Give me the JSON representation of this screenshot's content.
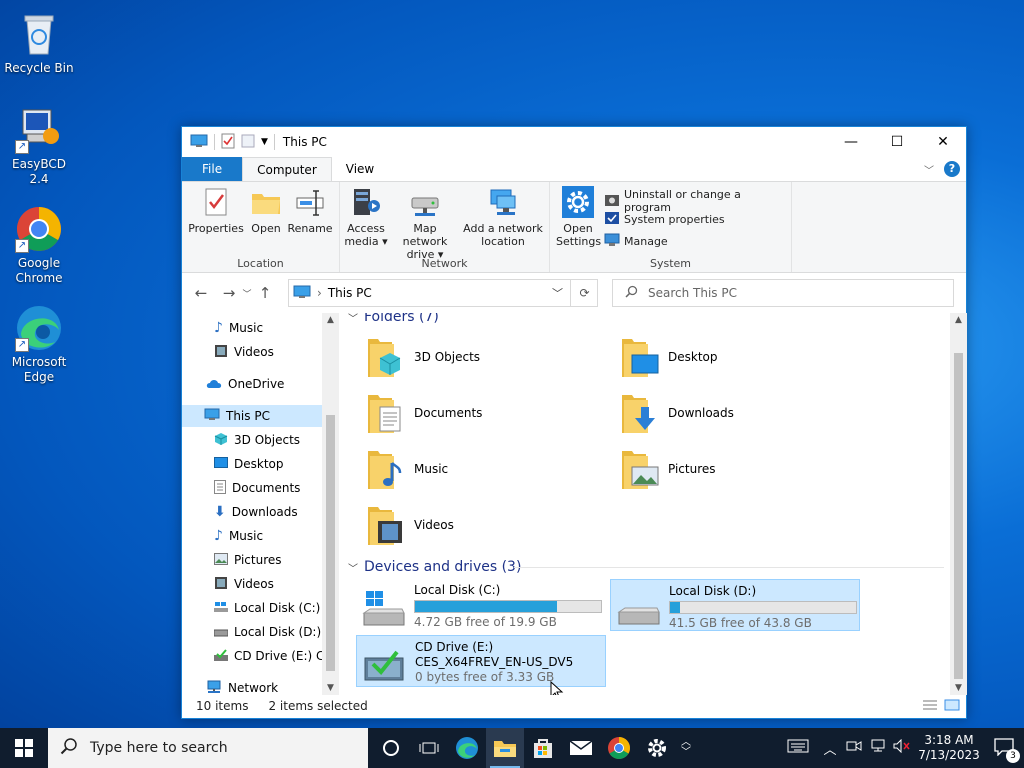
{
  "desktop": {
    "icons": [
      {
        "label": "Recycle Bin",
        "icon": "recycle-bin-icon"
      },
      {
        "label": "EasyBCD 2.4",
        "icon": "easybcd-icon"
      },
      {
        "label": "Google Chrome",
        "icon": "chrome-icon"
      },
      {
        "label": "Microsoft Edge",
        "icon": "edge-icon"
      }
    ]
  },
  "window": {
    "title": "This PC",
    "tabs": {
      "file": "File",
      "computer": "Computer",
      "view": "View"
    },
    "ribbon": {
      "location": {
        "label": "Location",
        "properties": "Properties",
        "open": "Open",
        "rename": "Rename"
      },
      "network": {
        "label": "Network",
        "access_media": "Access media",
        "map_network_drive": "Map network drive",
        "add_network_location": "Add a network location"
      },
      "system": {
        "label": "System",
        "open_settings": "Open Settings",
        "uninstall": "Uninstall or change a program",
        "system_properties": "System properties",
        "manage": "Manage"
      }
    },
    "address": {
      "path": "This PC",
      "search_placeholder": "Search This PC"
    },
    "nav": [
      {
        "label": "Music",
        "icon": "music-icon"
      },
      {
        "label": "Videos",
        "icon": "videos-icon"
      },
      {
        "label": "OneDrive",
        "icon": "onedrive-icon"
      },
      {
        "label": "This PC",
        "icon": "this-pc-icon",
        "selected": true
      },
      {
        "label": "3D Objects",
        "icon": "3d-objects-icon"
      },
      {
        "label": "Desktop",
        "icon": "desktop-icon"
      },
      {
        "label": "Documents",
        "icon": "documents-icon"
      },
      {
        "label": "Downloads",
        "icon": "downloads-icon"
      },
      {
        "label": "Music",
        "icon": "music-icon"
      },
      {
        "label": "Pictures",
        "icon": "pictures-icon"
      },
      {
        "label": "Videos",
        "icon": "videos-icon"
      },
      {
        "label": "Local Disk (C:)",
        "icon": "drive-icon"
      },
      {
        "label": "Local Disk (D:)",
        "icon": "drive-icon"
      },
      {
        "label": "CD Drive (E:) CES",
        "icon": "cd-drive-icon"
      },
      {
        "label": "Network",
        "icon": "network-icon"
      }
    ],
    "folders_header": "Folders (7)",
    "folders": [
      {
        "name": "3D Objects",
        "icon": "3d-objects-folder-icon"
      },
      {
        "name": "Desktop",
        "icon": "desktop-folder-icon"
      },
      {
        "name": "Documents",
        "icon": "documents-folder-icon"
      },
      {
        "name": "Downloads",
        "icon": "downloads-folder-icon"
      },
      {
        "name": "Music",
        "icon": "music-folder-icon"
      },
      {
        "name": "Pictures",
        "icon": "pictures-folder-icon"
      },
      {
        "name": "Videos",
        "icon": "videos-folder-icon"
      }
    ],
    "drives_header": "Devices and drives (3)",
    "drives": [
      {
        "name": "Local Disk (C:)",
        "free": "4.72 GB free of 19.9 GB",
        "used_fraction": 0.763,
        "selected": false
      },
      {
        "name": "Local Disk (D:)",
        "free": "41.5 GB free of 43.8 GB",
        "used_fraction": 0.053,
        "selected": true
      },
      {
        "name": "CD Drive (E:)",
        "volume": "CES_X64FREV_EN-US_DV5",
        "free": "0 bytes free of 3.33 GB",
        "selected": true
      }
    ],
    "status": {
      "items": "10 items",
      "selected": "2 items selected"
    }
  },
  "taskbar": {
    "search_placeholder": "Type here to search",
    "time": "3:18 AM",
    "date": "7/13/2023",
    "notification_count": "3"
  },
  "colors": {
    "accent": "#1979ca",
    "selection": "#cce8ff",
    "bar": "#26a0da",
    "taskbar": "#101d2e"
  }
}
